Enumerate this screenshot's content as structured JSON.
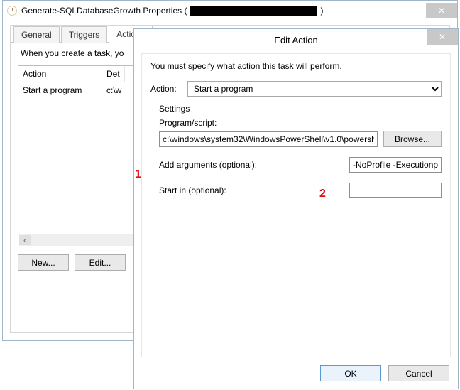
{
  "props": {
    "title_prefix": "Generate-SQLDatabaseGrowth Properties (",
    "title_suffix": ")",
    "tabs": {
      "general": "General",
      "triggers": "Triggers",
      "actions": "Actions"
    },
    "hint": "When you create a task, yo",
    "list": {
      "col_action": "Action",
      "col_details": "Det",
      "row0_action": "Start a program",
      "row0_details": "c:\\w"
    },
    "buttons": {
      "new": "New...",
      "edit": "Edit..."
    }
  },
  "edit": {
    "title": "Edit Action",
    "must": "You must specify what action this task will perform.",
    "action_label": "Action:",
    "action_value": "Start a program",
    "settings_head": "Settings",
    "program_label": "Program/script:",
    "program_value": "c:\\windows\\system32\\WindowsPowerShell\\v1.0\\powersh",
    "browse": "Browse...",
    "args_label": "Add arguments (optional):",
    "args_value": "-NoProfile -Executionpo",
    "startin_label": "Start in (optional):",
    "startin_value": "",
    "ok": "OK",
    "cancel": "Cancel"
  },
  "markers": {
    "one": "1",
    "two": "2"
  }
}
